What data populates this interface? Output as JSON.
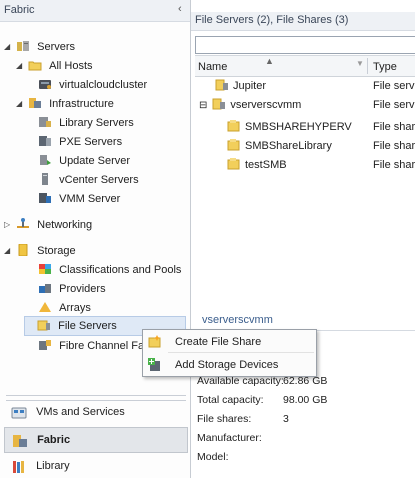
{
  "left_pane": {
    "header_title": "Fabric",
    "collapse_glyph": "‹",
    "tree": [
      {
        "id": "servers",
        "label": "Servers",
        "icon": "servers-icon",
        "expander": "◢"
      },
      {
        "id": "all-hosts",
        "label": "All Hosts",
        "icon": "folder-icon",
        "expander": "◢"
      },
      {
        "id": "virtualcloudcluster",
        "label": "virtualcloudcluster",
        "icon": "cluster-icon",
        "expander": ""
      },
      {
        "id": "infrastructure",
        "label": "Infrastructure",
        "icon": "infrastructure-icon",
        "expander": "◢"
      },
      {
        "id": "library-servers",
        "label": "Library Servers",
        "icon": "library-server-icon",
        "expander": ""
      },
      {
        "id": "pxe-servers",
        "label": "PXE Servers",
        "icon": "pxe-server-icon",
        "expander": ""
      },
      {
        "id": "update-server",
        "label": "Update Server",
        "icon": "update-server-icon",
        "expander": ""
      },
      {
        "id": "vcenter-servers",
        "label": "vCenter Servers",
        "icon": "vcenter-server-icon",
        "expander": ""
      },
      {
        "id": "vmm-server",
        "label": "VMM Server",
        "icon": "vmm-server-icon",
        "expander": ""
      },
      {
        "id": "networking",
        "label": "Networking",
        "icon": "networking-icon",
        "expander": "▷"
      },
      {
        "id": "storage",
        "label": "Storage",
        "icon": "storage-icon",
        "expander": "◢"
      },
      {
        "id": "classifications",
        "label": "Classifications and Pools",
        "icon": "classifications-icon",
        "expander": ""
      },
      {
        "id": "providers",
        "label": "Providers",
        "icon": "providers-icon",
        "expander": ""
      },
      {
        "id": "arrays",
        "label": "Arrays",
        "icon": "arrays-icon",
        "expander": ""
      },
      {
        "id": "file-servers",
        "label": "File Servers",
        "icon": "file-servers-icon",
        "expander": ""
      },
      {
        "id": "fibre-channel",
        "label": "Fibre Channel Fabrics",
        "icon": "fibre-channel-icon",
        "expander": ""
      }
    ],
    "workspaces": [
      {
        "id": "vms-and-services",
        "label": "VMs and Services",
        "icon": "vms-and-services-icon"
      },
      {
        "id": "fabric",
        "label": "Fabric",
        "icon": "fabric-icon"
      },
      {
        "id": "library",
        "label": "Library",
        "icon": "library-icon"
      }
    ]
  },
  "right_pane": {
    "header_title": "File Servers (2), File Shares (3)",
    "search_value": "",
    "columns": {
      "name": "Name",
      "type": "Type"
    },
    "rows": [
      {
        "name": "Jupiter",
        "type": "File serve",
        "icon": "file-server-icon",
        "indent": 0,
        "expander": ""
      },
      {
        "name": "vserverscvmm",
        "type": "File serve",
        "icon": "file-server-icon",
        "indent": 0,
        "expander": "⊟"
      },
      {
        "name": "SMBSHAREHYPERV",
        "type": "File share",
        "icon": "file-share-icon",
        "indent": 1,
        "expander": ""
      },
      {
        "name": "SMBShareLibrary",
        "type": "File share",
        "icon": "file-share-icon",
        "indent": 1,
        "expander": ""
      },
      {
        "name": "testSMB",
        "type": "File share",
        "icon": "file-share-icon",
        "indent": 1,
        "expander": ""
      }
    ],
    "details": {
      "title": "vserverscvmm",
      "rows": [
        {
          "label": "Available capacity:",
          "value": "62.86 GB"
        },
        {
          "label": "Total capacity:",
          "value": "98.00 GB"
        },
        {
          "label": "File shares:",
          "value": "3"
        },
        {
          "label": "Manufacturer:",
          "value": ""
        },
        {
          "label": "Model:",
          "value": ""
        }
      ]
    }
  },
  "context_menu": {
    "items": [
      {
        "label": "Create File Share",
        "icon": "create-file-share-icon"
      },
      {
        "label": "Add Storage Devices",
        "icon": "add-storage-devices-icon"
      }
    ]
  },
  "colors": {
    "selection": "#dfe9f6",
    "header_bg": "#eef1f5",
    "accent_text": "#3a5d8c"
  }
}
